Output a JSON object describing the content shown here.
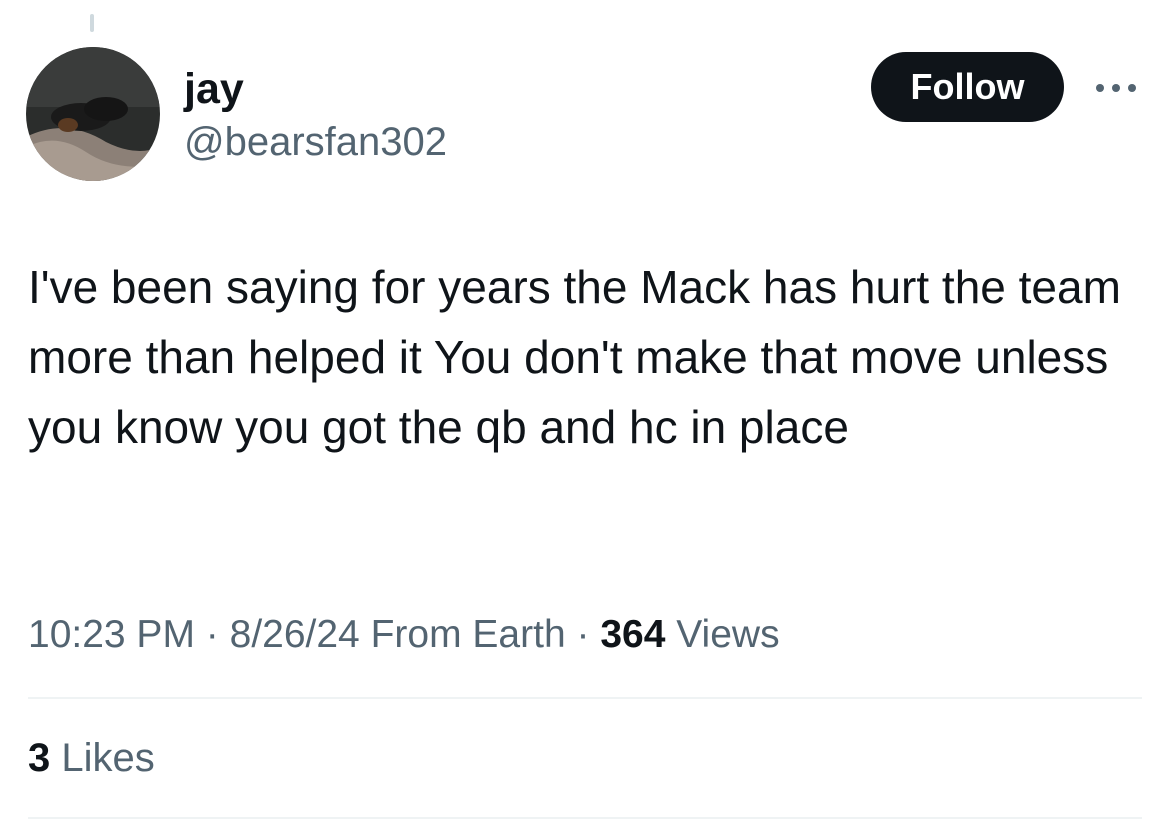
{
  "tweet": {
    "author": {
      "display_name": "jay",
      "handle": "@bearsfan302"
    },
    "follow_label": "Follow",
    "more_icon": "more-horizontal-icon",
    "text": "I've been saying for years the Mack has hurt the team more than helped it You don't make that move unless you know you got the qb and hc in place",
    "time": "10:23 PM",
    "separator": "·",
    "date": "8/26/24",
    "location": "From Earth",
    "views_count": "364",
    "views_label": "Views",
    "likes_count": "3",
    "likes_label": "Likes"
  },
  "colors": {
    "primary_text": "#0f1419",
    "secondary_text": "#536471",
    "follow_button_bg": "#0f1419",
    "divider": "#eff3f4"
  }
}
